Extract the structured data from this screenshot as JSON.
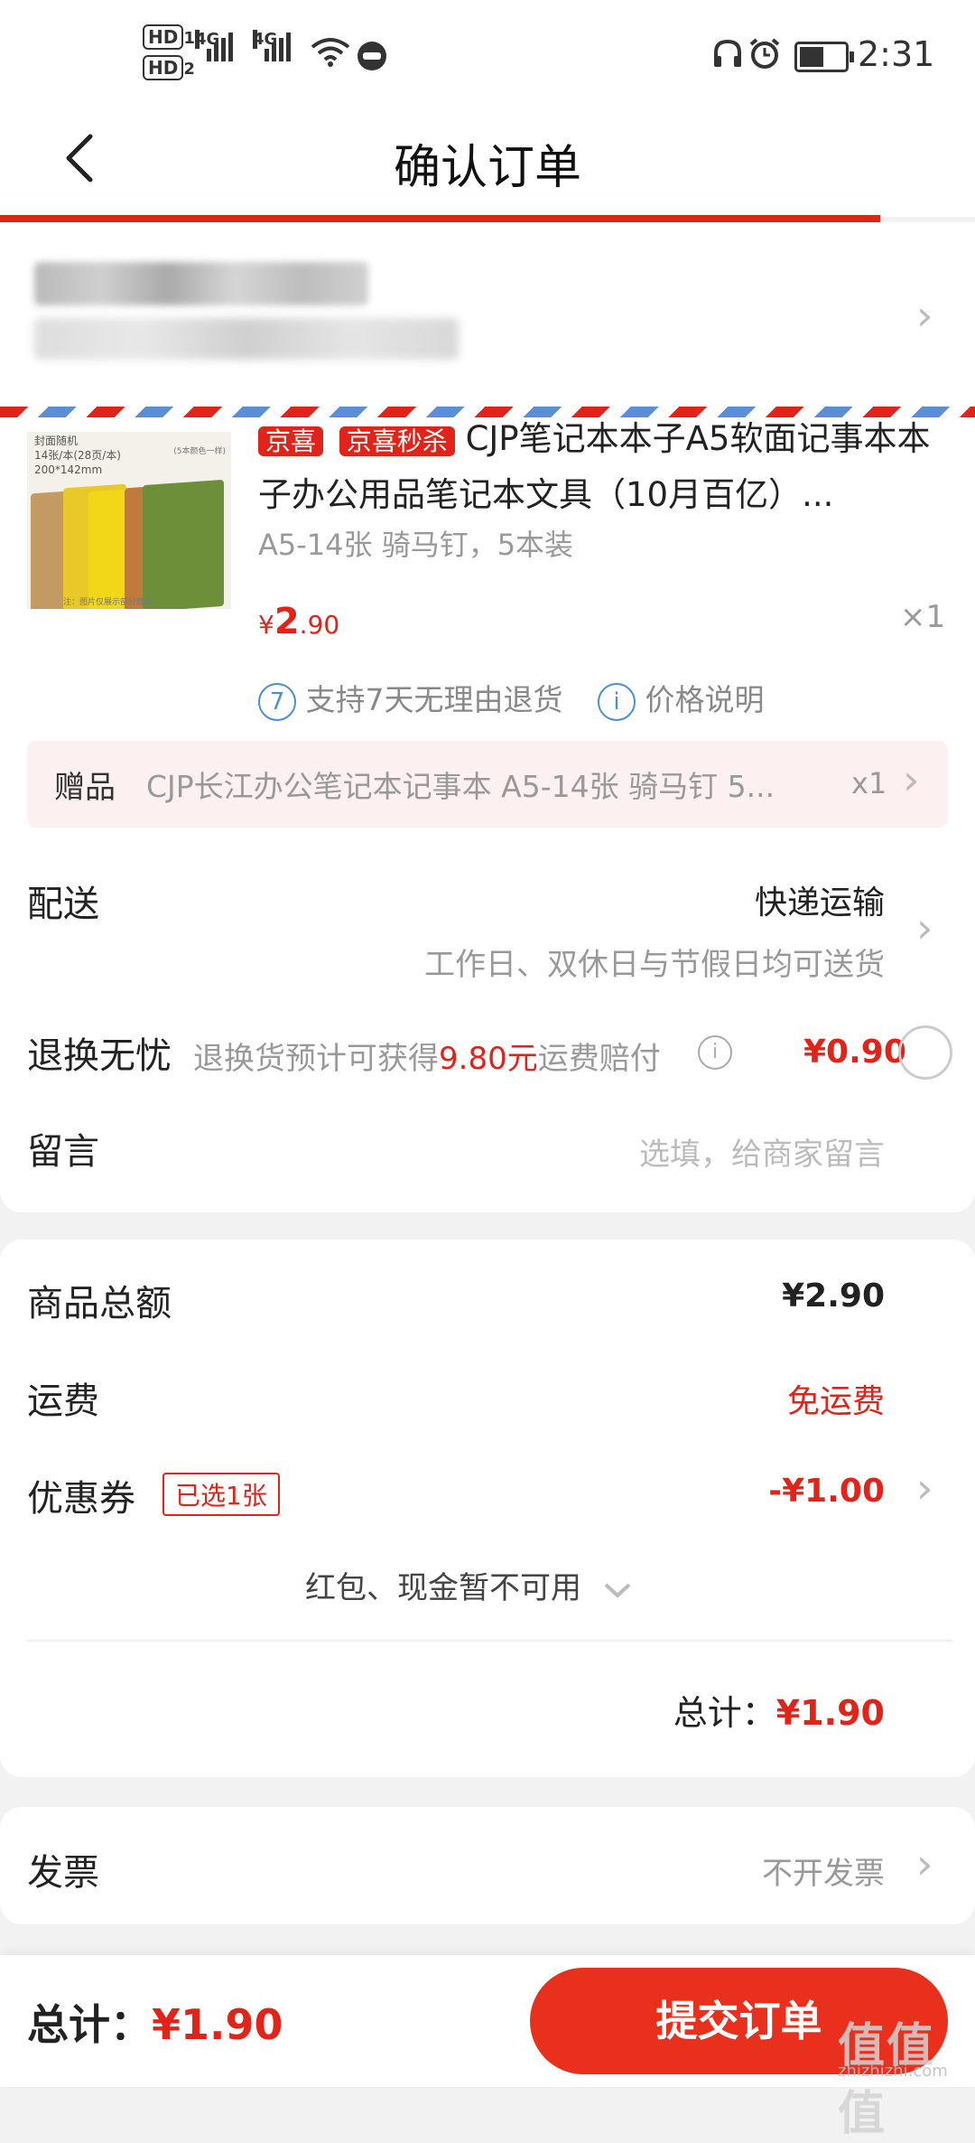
{
  "status_bar": {
    "hd1": "HD",
    "hd1_sub": "1",
    "hd2": "HD",
    "hd2_sub": "2",
    "net1": "4G",
    "net2": "4G",
    "time": "2:31"
  },
  "header": {
    "title": "确认订单"
  },
  "product": {
    "tag_jx": "京喜",
    "tag_sale": "京喜秒杀",
    "name": "CJP笔记本本子A5软面记事本本子办公用品笔记本文具（10月百亿）...",
    "spec": "A5-14张 骑马钉，5本装",
    "price_symbol": "¥",
    "price_int": "2",
    "price_dec": ".90",
    "quantity": "×1",
    "image_text": [
      "封面随机",
      "14张/本(28页/本)",
      "200*142mm",
      "(5本颜色一样)",
      "注：图片仅展示部分颜色"
    ],
    "service_icon_1": "7",
    "service_1": "支持7天无理由退货",
    "service_icon_2": "i",
    "service_2": "价格说明"
  },
  "gift": {
    "label": "赠品",
    "name": "CJP长江办公笔记本记事本 A5-14张 骑马钉 5...",
    "quantity": "x1"
  },
  "delivery": {
    "label": "配送",
    "method": "快递运输",
    "note": "工作日、双休日与节假日均可送货"
  },
  "return_insurance": {
    "label": "退换无忧",
    "desc_prefix": "退换货预计可获得",
    "desc_amount": "9.80元",
    "desc_suffix": "运费赔付",
    "price": "¥0.90"
  },
  "message": {
    "label": "留言",
    "placeholder": "选填，给商家留言"
  },
  "summary": {
    "goods_label": "商品总额",
    "goods_value": "¥2.90",
    "shipping_label": "运费",
    "shipping_value": "免运费",
    "coupon_label": "优惠券",
    "coupon_badge": "已选1张",
    "coupon_value": "-¥1.00",
    "redpacket_note": "红包、现金暂不可用",
    "total_label": "总计：",
    "total_value": "¥1.90"
  },
  "invoice": {
    "label": "发票",
    "value": "不开发票"
  },
  "bottom_bar": {
    "total_label": "总计：",
    "total_value": "¥1.90",
    "submit_label": "提交订单"
  },
  "watermark": {
    "text": "值值值",
    "url": "zhizhizhi.com"
  },
  "colors": {
    "accent": "#e2231a",
    "submit": "#e8301c",
    "service_blue": "#4a8fd6"
  }
}
